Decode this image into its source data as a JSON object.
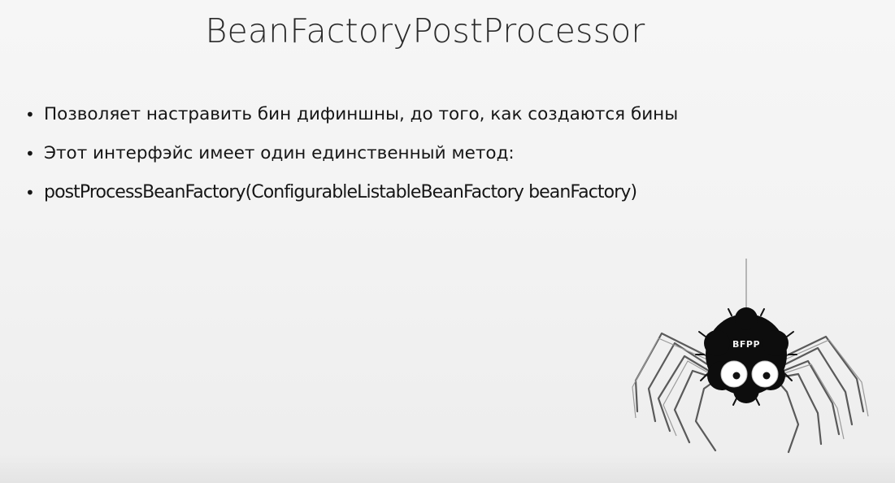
{
  "slide": {
    "title": "BeanFactoryPostProcessor",
    "bullets": [
      "Позволяет настравить бин дифиншны, до того, как создаются бины",
      "Этот интерфэйс имеет один единственный метод:",
      "postProcessBeanFactory(ConfigurableListableBeanFactory beanFactory)"
    ],
    "bullet_glyph": "•",
    "mascot": {
      "icon": "spider-icon",
      "label": "BFPP"
    }
  }
}
